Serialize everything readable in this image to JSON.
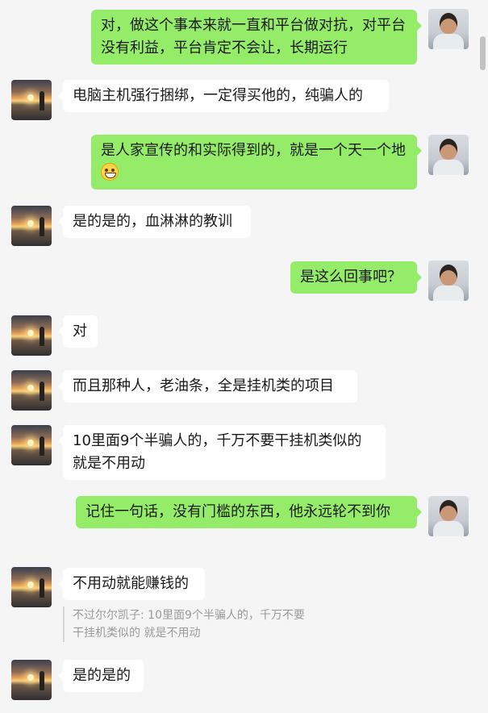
{
  "chat": {
    "messages": [
      {
        "side": "out",
        "text": "对，做这个事本来就一直和平台做对抗，对平台没有利益，平台肯定不会让，长期运行"
      },
      {
        "side": "in",
        "text": "电脑主机强行捆绑，一定得买他的，纯骗人的"
      },
      {
        "side": "out",
        "text": "是人家宣传的和实际得到的，就是一个天一个地",
        "emoji": "grin-icon"
      },
      {
        "side": "in",
        "text": "是的是的，血淋淋的教训"
      },
      {
        "side": "out",
        "text": "是这么回事吧？"
      },
      {
        "side": "in",
        "text": "对"
      },
      {
        "side": "in",
        "text": "而且那种人，老油条，全是挂机类的项目"
      },
      {
        "side": "in",
        "text": "10里面9个半骗人的，千万不要干挂机类似的 就是不用动"
      },
      {
        "side": "out",
        "text": "记住一句话，没有门槛的东西，他永远轮不到你"
      },
      {
        "side": "in",
        "text": "不用动就能赚钱的",
        "quote": "不过尔尔凯子: 10里面9个半骗人的，千万不要干挂机类似的 就是不用动"
      },
      {
        "side": "in",
        "text": "是的是的"
      }
    ]
  },
  "colors": {
    "outgoing_bubble": "#95ec69",
    "incoming_bubble": "#ffffff",
    "background": "#f5f5f5"
  }
}
